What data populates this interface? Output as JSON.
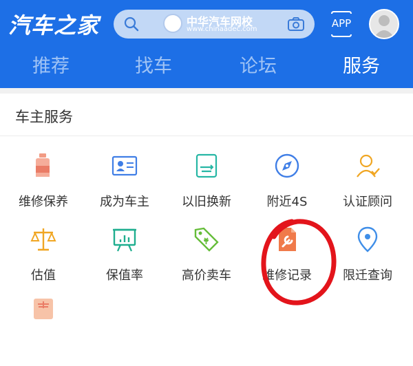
{
  "header": {
    "logo": "汽车之家",
    "search": {
      "watermark_title": "中华汽车网校",
      "watermark_url": "www.chinaadec.com"
    },
    "app_label": "APP"
  },
  "tabs": [
    {
      "label": "推荐",
      "active": false
    },
    {
      "label": "找车",
      "active": false
    },
    {
      "label": "论坛",
      "active": false
    },
    {
      "label": "服务",
      "active": true
    }
  ],
  "section": {
    "title": "车主服务",
    "items": [
      {
        "label": "维修保养",
        "icon": "oil-bottle-icon"
      },
      {
        "label": "成为车主",
        "icon": "id-card-icon"
      },
      {
        "label": "以旧换新",
        "icon": "trade-in-icon"
      },
      {
        "label": "附近4S",
        "icon": "compass-icon"
      },
      {
        "label": "认证顾问",
        "icon": "advisor-icon"
      },
      {
        "label": "估值",
        "icon": "scale-icon"
      },
      {
        "label": "保值率",
        "icon": "presentation-board-icon"
      },
      {
        "label": "高价卖车",
        "icon": "price-tag-icon"
      },
      {
        "label": "维修记录",
        "icon": "wrench-document-icon"
      },
      {
        "label": "限迁查询",
        "icon": "location-pin-icon"
      },
      {
        "label": "",
        "icon": "partial-icon"
      }
    ]
  },
  "colors": {
    "header_bg": "#1d6fe6",
    "tab_inactive": "#9fc3f5",
    "tab_active": "#ffffff",
    "annotation_red": "#e3141b"
  }
}
